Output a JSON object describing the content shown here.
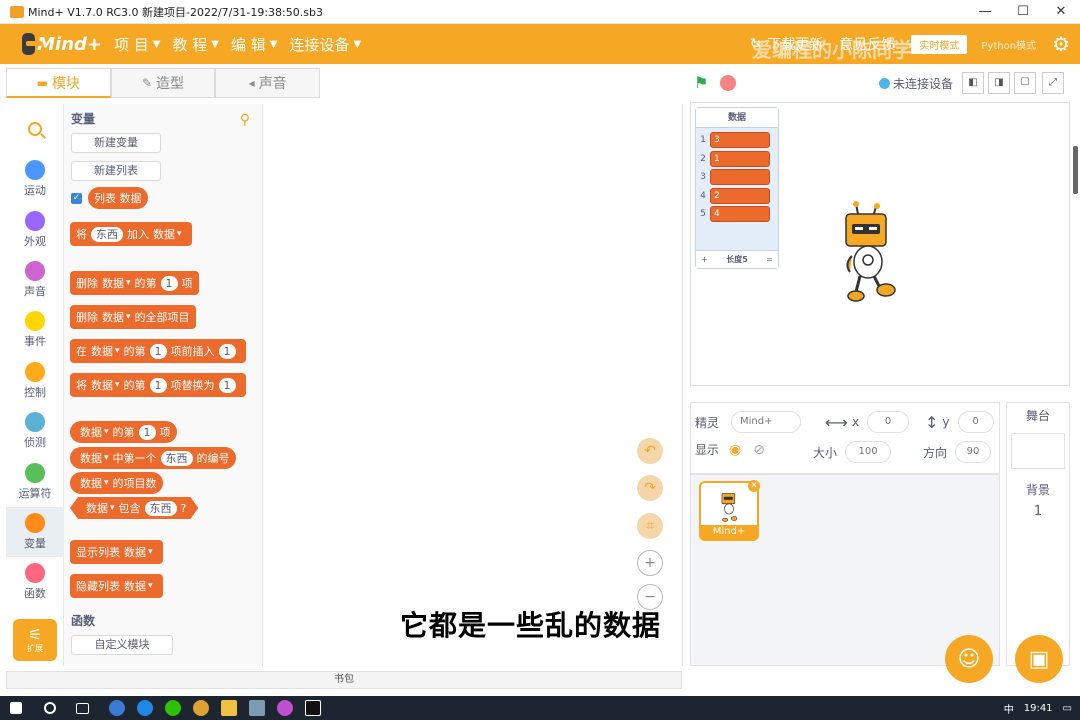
{
  "window": {
    "title": "Mind+ V1.7.0 RC3.0   新建项目-2022/7/31-19:38:50.sb3",
    "controls": [
      "—",
      "☐",
      "✕"
    ]
  },
  "menubar": {
    "logo": "Mind+",
    "items": [
      "项 目",
      "教 程",
      "编 辑",
      "连接设备"
    ],
    "update": "下载更新",
    "feedback": "意见反馈",
    "mode": "实时模式",
    "python": "Python模式"
  },
  "watermark": "爱编程的小陈同学",
  "tabs": {
    "blocks": "模块",
    "costumes": "造型",
    "sounds": "声音"
  },
  "categories": [
    {
      "label": "运动",
      "color": "#4c97ff"
    },
    {
      "label": "外观",
      "color": "#9966ff"
    },
    {
      "label": "声音",
      "color": "#cf63cf"
    },
    {
      "label": "事件",
      "color": "#ffd500"
    },
    {
      "label": "控制",
      "color": "#ffab19"
    },
    {
      "label": "侦测",
      "color": "#5cb1d6"
    },
    {
      "label": "运算符",
      "color": "#59c059"
    },
    {
      "label": "变量",
      "color": "#ff8c1a"
    },
    {
      "label": "函数",
      "color": "#ff6680"
    }
  ],
  "extension": {
    "label": "扩展"
  },
  "palette": {
    "variables_title": "变量",
    "new_variable": "新建变量",
    "new_list": "新建列表",
    "list_reporter": "列表 数据",
    "blocks": {
      "add": {
        "a": "将",
        "item": "东西",
        "b": "加入",
        "list": "数据"
      },
      "delete_nth": {
        "a": "删除",
        "list": "数据",
        "b": "的第",
        "n": "1",
        "c": "项"
      },
      "delete_all": {
        "a": "删除",
        "list": "数据",
        "b": "的全部项目"
      },
      "insert": {
        "a": "在",
        "list": "数据",
        "b": "的第",
        "n": "1",
        "c": "项前插入",
        "d": "1"
      },
      "replace": {
        "a": "将",
        "list": "数据",
        "b": "的第",
        "n": "1",
        "c": "项替换为",
        "d": "1"
      },
      "item_of": {
        "list": "数据",
        "a": "的第",
        "n": "1",
        "b": "项"
      },
      "index_of": {
        "list": "数据",
        "a": "中第一个",
        "item": "东西",
        "b": "的编号"
      },
      "length": {
        "list": "数据",
        "a": "的项目数"
      },
      "contains": {
        "list": "数据",
        "a": "包含",
        "item": "东西",
        "b": "?"
      },
      "show": {
        "a": "显示列表",
        "list": "数据"
      },
      "hide": {
        "a": "隐藏列表",
        "list": "数据"
      }
    },
    "functions_title": "函数",
    "custom_block": "自定义模块"
  },
  "subtitle": "它都是一些乱的数据",
  "backpack": "书包",
  "stage_header": {
    "device_status": "未连接设备"
  },
  "list_monitor": {
    "title": "数据",
    "items": [
      {
        "index": "1",
        "value": "3"
      },
      {
        "index": "2",
        "value": "1"
      },
      {
        "index": "3",
        "value": ""
      },
      {
        "index": "4",
        "value": "2"
      },
      {
        "index": "5",
        "value": "4"
      }
    ],
    "add": "+",
    "length_label": "长度5",
    "resize": "="
  },
  "sprite_info": {
    "sprite_label": "精灵",
    "sprite_name": "Mind+",
    "x_label": "x",
    "x_value": "0",
    "y_label": "y",
    "y_value": "0",
    "show_label": "显示",
    "size_label": "大小",
    "size_value": "100",
    "direction_label": "方向",
    "direction_value": "90"
  },
  "sprite_thumb": {
    "label": "Mind+"
  },
  "stage_panel": {
    "title": "舞台",
    "backdrop_label": "背景",
    "backdrop_count": "1"
  },
  "taskbar": {
    "ime": "中",
    "time": "19:41"
  }
}
